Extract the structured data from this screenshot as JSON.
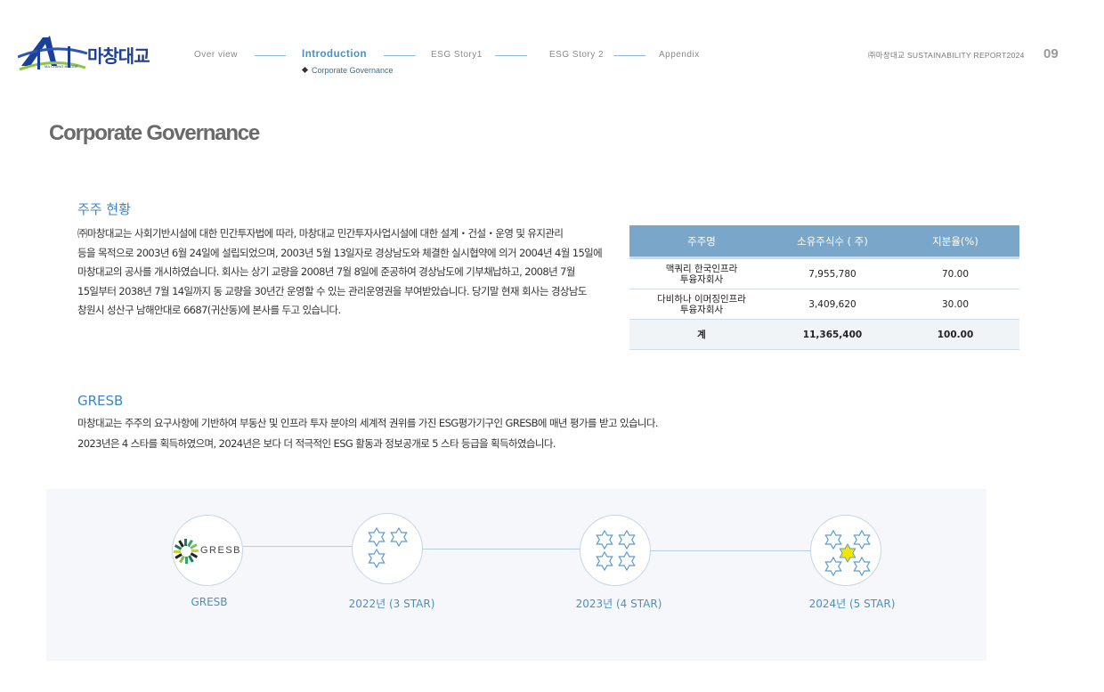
{
  "header": {
    "logo_text": "마창대교",
    "logo_small": "MA CHANG BRIDGE",
    "nav": [
      "Over view",
      "Introduction",
      "ESG Story1",
      "ESG Story 2",
      "Appendix"
    ],
    "nav_sub": "Corporate Governance",
    "report": "㈜마창대교 SUSTAINABILITY REPORT2024",
    "page_number": "09"
  },
  "page_title": "Corporate Governance",
  "shareholders": {
    "title": "주주 현황",
    "lines": [
      "㈜마창대교는 사회기반시설에 대한 민간투자법에 따라, 마창대교 민간투자사업시설에 대한 설계・건설・운영 및 유지관리",
      "등을 목적으로 2003년 6월 24일에 설립되었으며, 2003년 5월 13일자로 경상남도와 체결한 실시협약에 의거 2004년 4월 15일에",
      "마창대교의 공사를 개시하였습니다. 회사는 상기 교량을 2008년 7월 8일에 준공하여 경상남도에 기부채납하고, 2008년 7월",
      "15일부터 2038년 7월 14일까지 동 교량을 30년간 운영할 수 있는 관리운영권을 부여받았습니다.  당기말 현재 회사는 경상남도",
      "창원시 성산구 남해안대로 6687(귀산동)에 본사를 두고 있습니다."
    ],
    "table": {
      "headers": [
        "주주명",
        "소유주식수 ( 주)",
        "지분율(%)"
      ],
      "rows": [
        [
          "맥쿼리 한국인프라\n투융자회사",
          "7,955,780",
          "70.00"
        ],
        [
          "다비하나 이머징인프라\n투융자회사",
          "3,409,620",
          "30.00"
        ]
      ],
      "total": [
        "계",
        "11,365,400",
        "100.00"
      ]
    }
  },
  "gresb": {
    "title": "GRESB",
    "lines": [
      "마창대교는 주주의 요구사항에 기반하여 부동산 및 인프라 투자 분야의 세계적 권위를 가진 ESG평가기구인 GRESB에 매년 평가를 받고 있습니다.",
      "2023년은 4 스타를  획득하였으며, 2024년은 보다 더 적극적인 ESG 활동과 정보공개로 5 스타 등급을  획득하였습니다."
    ],
    "logo_text": "GRESB",
    "milestones": [
      {
        "label": "GRESB",
        "stars": 0
      },
      {
        "label": "2022년 (3 STAR)",
        "stars": 3
      },
      {
        "label": "2023년 (4 STAR)",
        "stars": 4
      },
      {
        "label": "2024년 (5 STAR)",
        "stars": 5
      }
    ],
    "colors": {
      "star_outline": "#5b9bd0",
      "star_highlight": "#f5e400"
    }
  }
}
